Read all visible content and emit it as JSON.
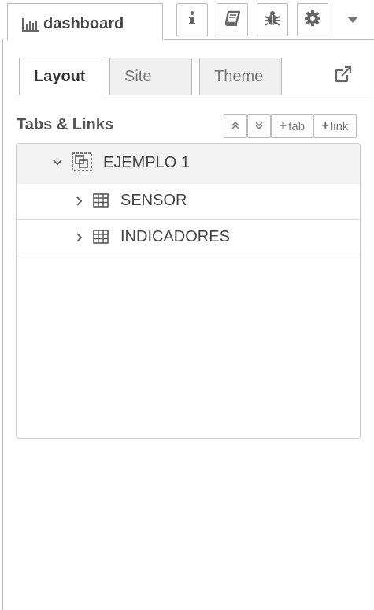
{
  "topbar": {
    "main_tab_label": "dashboard",
    "buttons": [
      "info-icon",
      "book-icon",
      "bug-icon",
      "gear-icon"
    ],
    "dropdown": "caret-down-icon"
  },
  "subtabs": {
    "items": [
      {
        "label": "Layout",
        "active": true
      },
      {
        "label": "Site",
        "active": false
      },
      {
        "label": "Theme",
        "active": false
      }
    ]
  },
  "section": {
    "title": "Tabs & Links",
    "collapse_all": "double-chevron-up-icon",
    "expand_all": "double-chevron-down-icon",
    "add_tab_label": "tab",
    "add_link_label": "link"
  },
  "tree": {
    "group": {
      "label": "EJEMPLO 1",
      "expanded": true
    },
    "children": [
      {
        "label": "SENSOR"
      },
      {
        "label": "INDICADORES"
      }
    ]
  },
  "colors": {
    "border": "#bbbbbb",
    "inactive_tab_bg": "#f0f0f0",
    "group_row_bg": "#f3f3f3",
    "text": "#444444"
  }
}
